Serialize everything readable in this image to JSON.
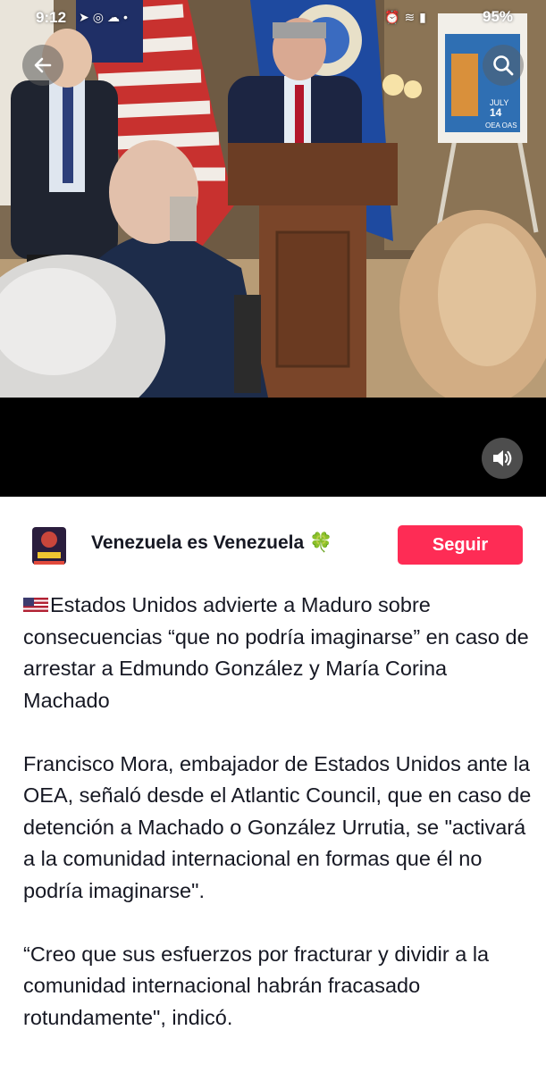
{
  "status_bar": {
    "time": "9:12",
    "battery": "95%",
    "left_icons": [
      "location-arrow-icon",
      "messenger-icon",
      "weather-icon",
      "dot-icon"
    ],
    "right_icons": [
      "alarm-icon",
      "wifi-icon",
      "signal-icon"
    ]
  },
  "media": {
    "back_icon": "arrow-left-icon",
    "search_icon": "search-icon",
    "volume_icon": "speaker-icon",
    "poster_text": {
      "line1": "JULY",
      "date": "14",
      "org": "OEA OAS"
    }
  },
  "author": {
    "name": "Venezuela es Venezuela",
    "emoji": "🍀",
    "follow_label": "Seguir",
    "accent_color": "#fe2c55"
  },
  "caption": {
    "headline": "Estados Unidos advierte a Maduro sobre consecuencias “que no podría imaginarse” en caso de arrestar a Edmundo González y María Corina Machado",
    "paragraph1": "Francisco Mora, embajador de Estados Unidos ante la OEA, señaló desde el Atlantic Council, que en caso de detención a Machado o González Urrutia, se \"activará a la comunidad internacional en formas que él no podría imaginarse\".",
    "paragraph2": "“Creo que sus esfuerzos por fracturar y dividir a la comunidad internacional habrán fracasado rotundamente\", indicó."
  }
}
